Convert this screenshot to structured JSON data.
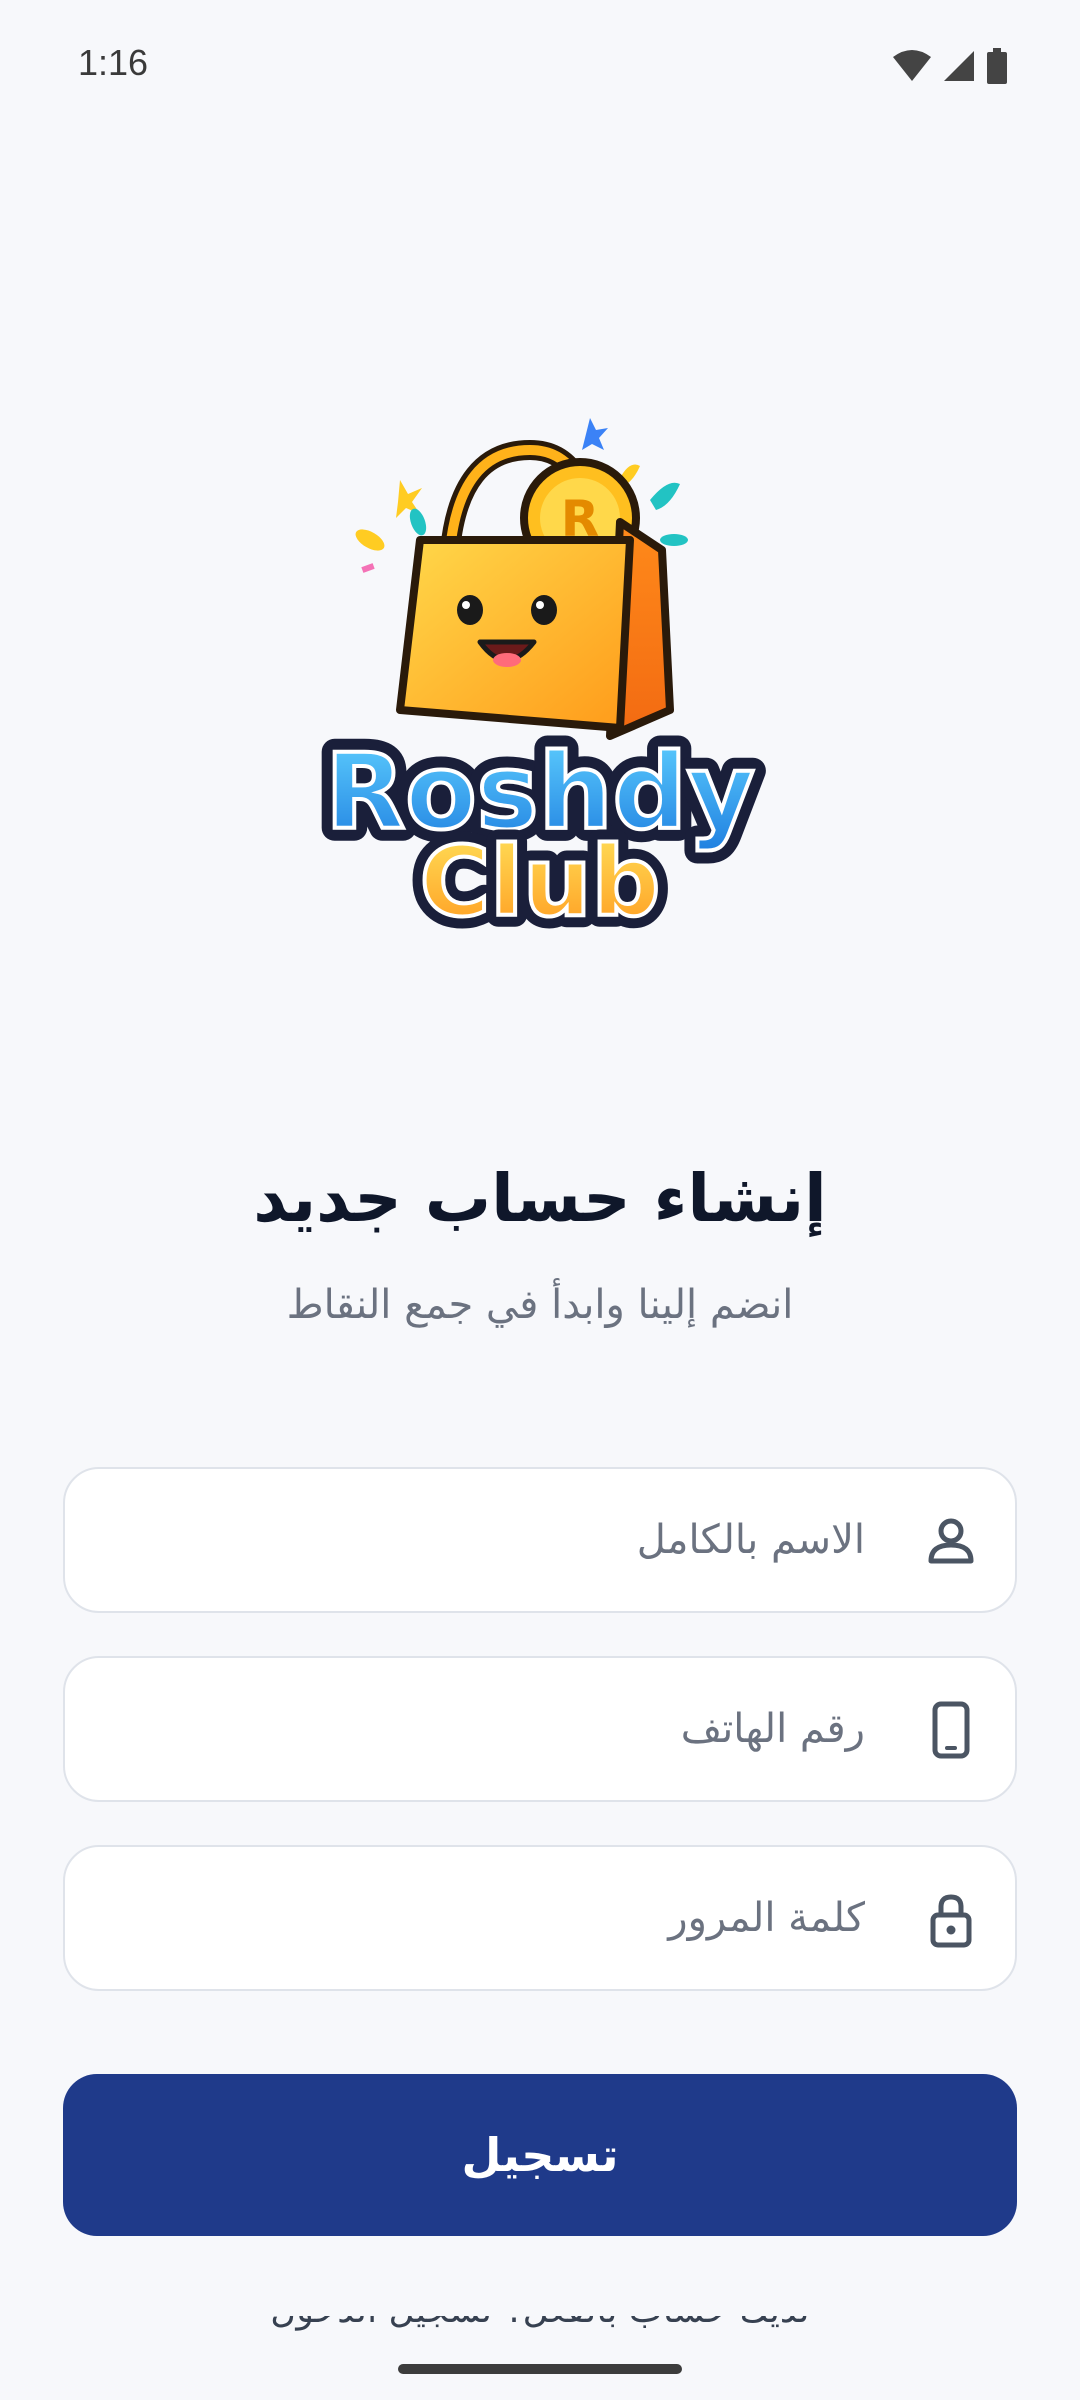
{
  "status_bar": {
    "time": "1:16"
  },
  "logo": {
    "line1": "Roshdy",
    "line2": "Club",
    "coin_letter": "R"
  },
  "header": {
    "title": "إنشاء حساب جديد",
    "subtitle": "انضم إلينا وابدأ في جمع النقاط"
  },
  "form": {
    "full_name": {
      "placeholder": "الاسم بالكامل",
      "value": ""
    },
    "phone": {
      "placeholder": "رقم الهاتف",
      "value": ""
    },
    "password": {
      "placeholder": "كلمة المرور",
      "value": ""
    },
    "submit_label": "تسجيل"
  },
  "footer": {
    "login_prompt": "لديك حساب بالفعل؟ تسجيل الدخول"
  },
  "colors": {
    "primary": "#1f3a8a",
    "background": "#f7f8fb",
    "field_border": "#dfe3ea",
    "placeholder": "#6b7280"
  }
}
